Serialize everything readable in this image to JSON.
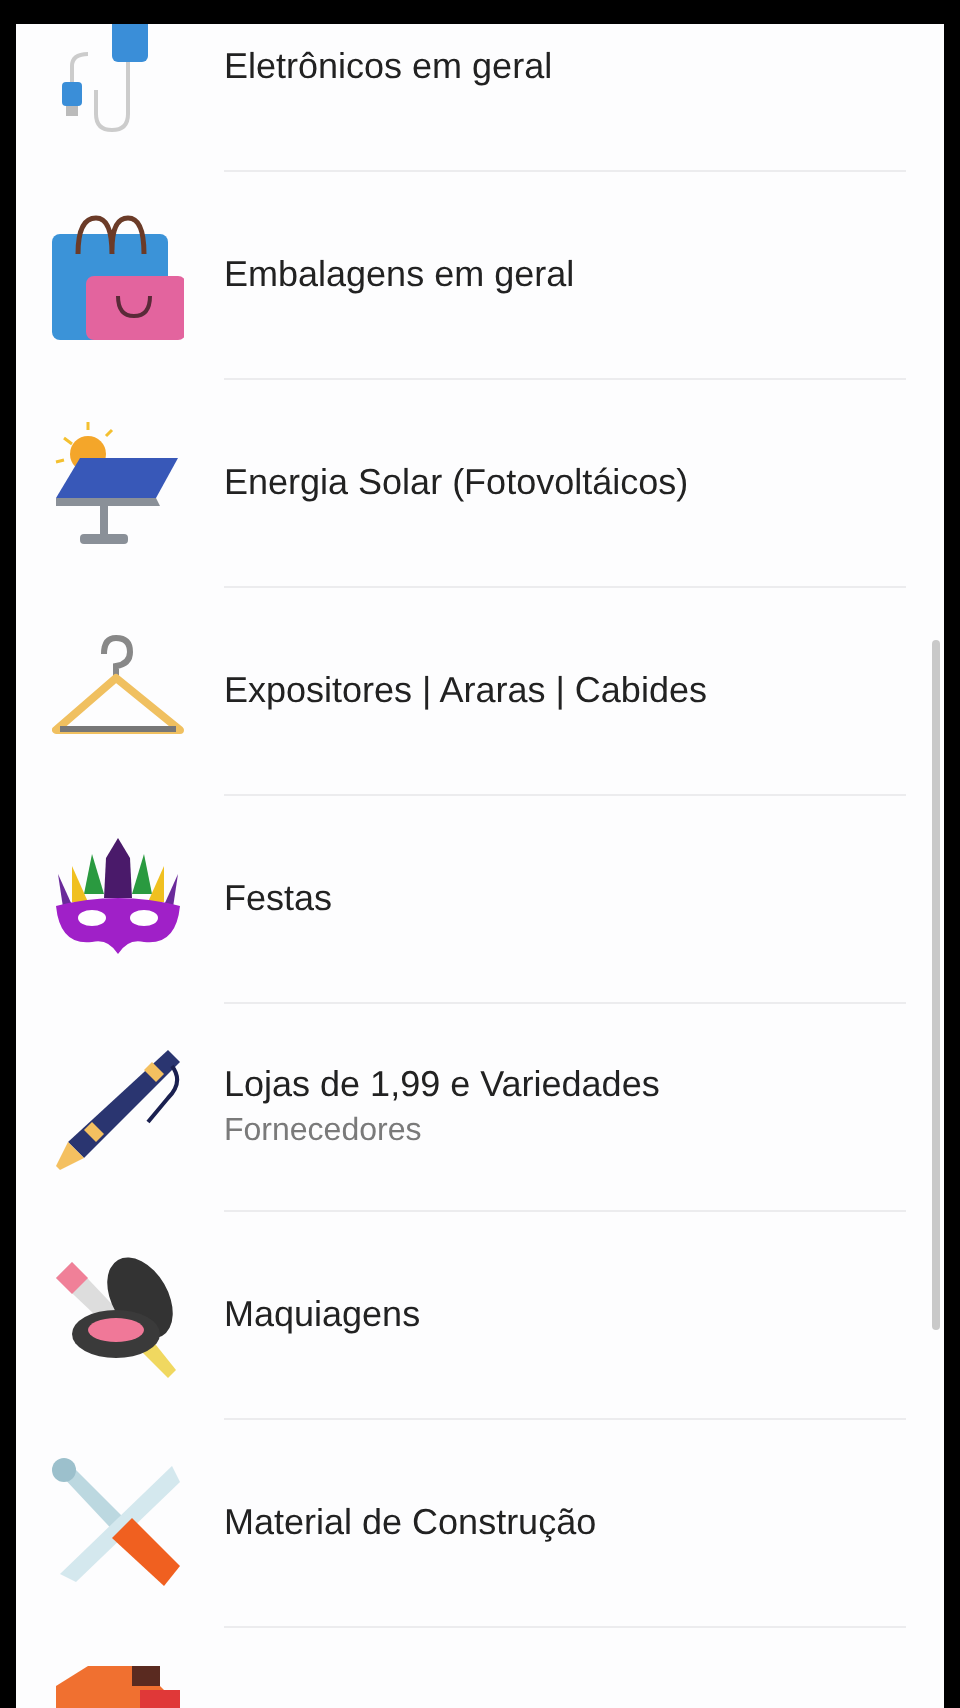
{
  "categories": [
    {
      "kind": "category",
      "label": "Eletrônicos em geral"
    },
    {
      "kind": "category",
      "label": "Embalagens em geral"
    },
    {
      "kind": "category",
      "label": "Energia Solar (Fotovoltáicos)"
    },
    {
      "kind": "category",
      "label": "Expositores | Araras | Cabides"
    },
    {
      "kind": "category",
      "label": "Festas"
    },
    {
      "kind": "category",
      "label": "Lojas de 1,99 e Variedades",
      "subtitle": "Fornecedores"
    },
    {
      "kind": "category",
      "label": "Maquiagens"
    },
    {
      "kind": "category",
      "label": "Material de Construção"
    },
    {
      "kind": "category"
    }
  ]
}
